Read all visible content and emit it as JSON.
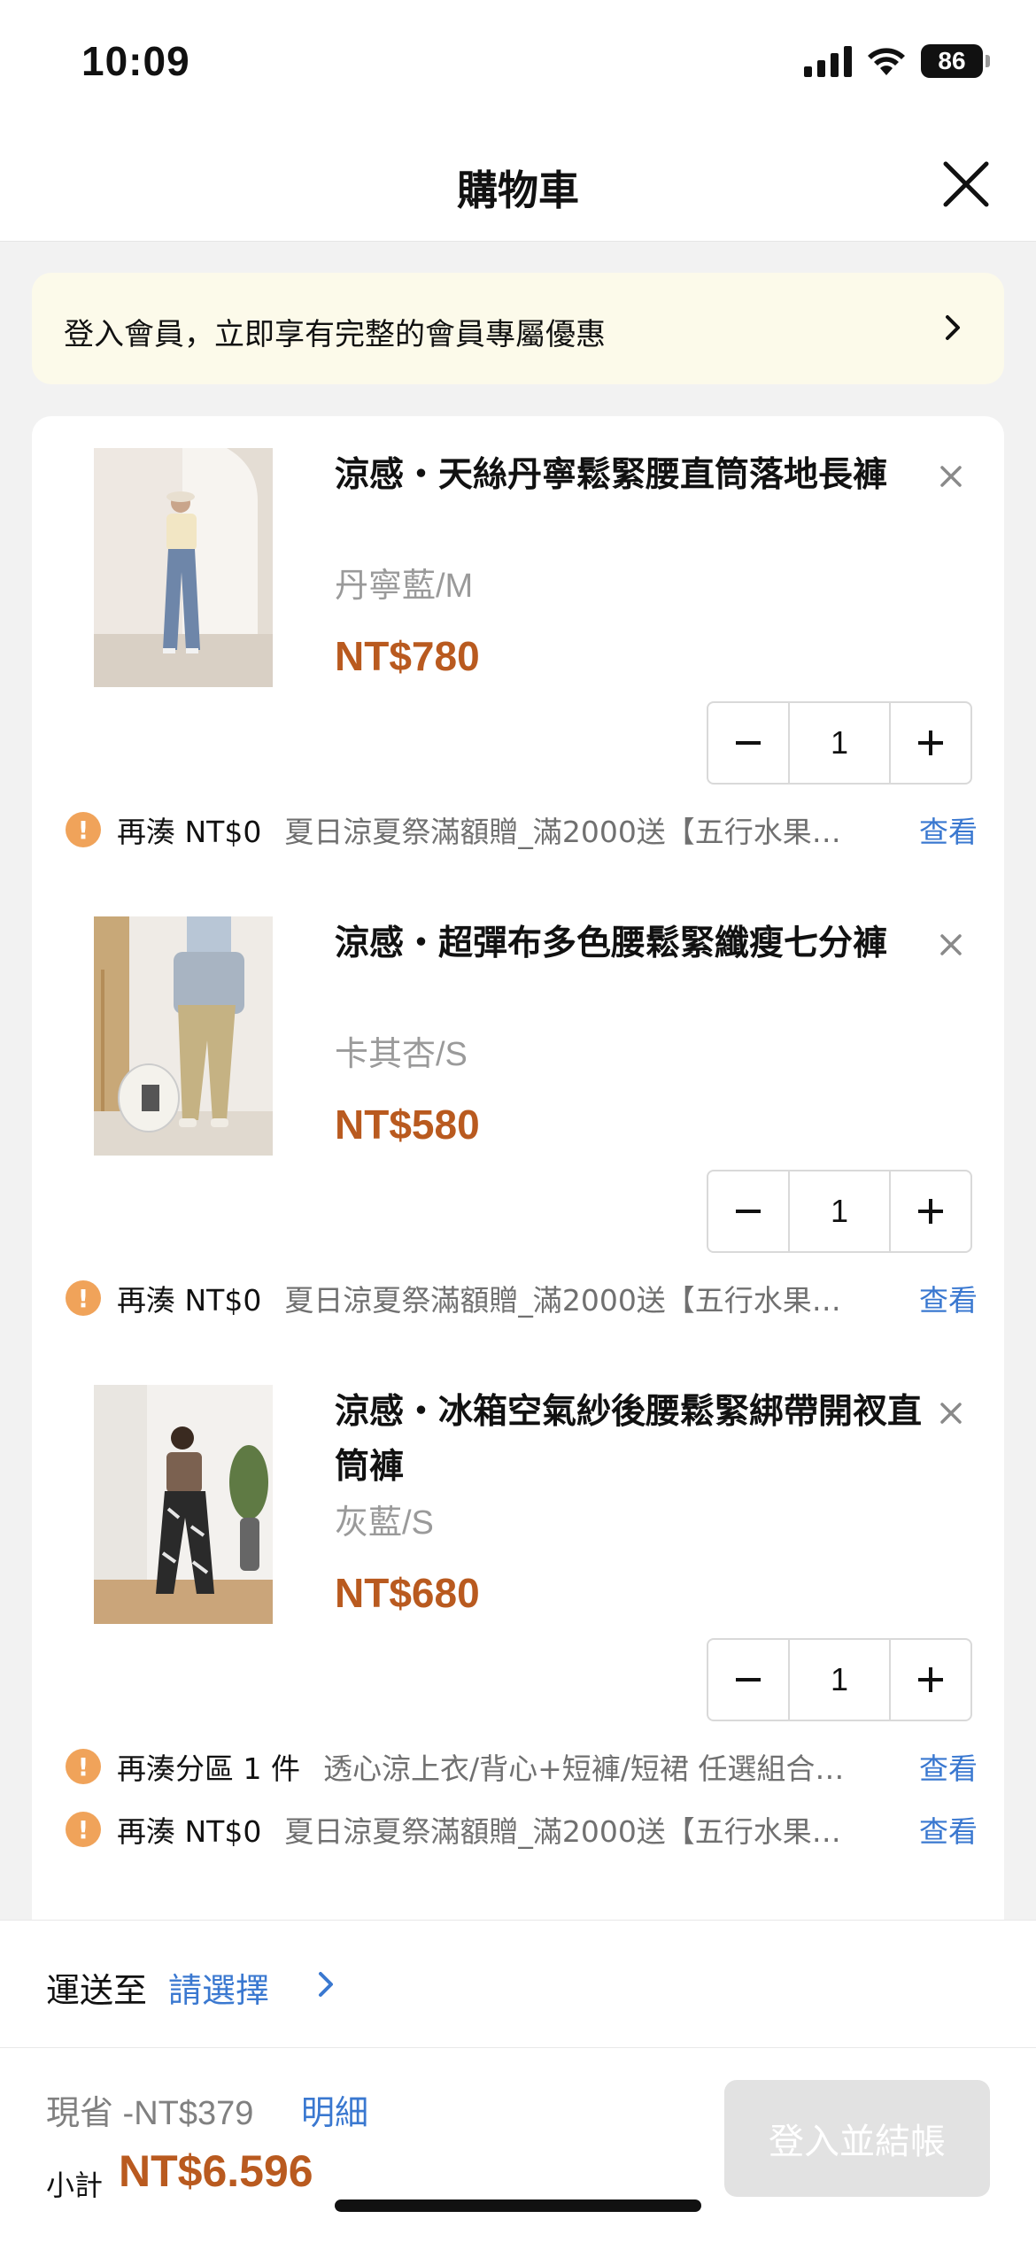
{
  "status": {
    "time": "10:09",
    "battery": "86"
  },
  "header": {
    "title": "購物車"
  },
  "member_banner": {
    "text": "登入會員，立即享有完整的會員專屬優惠"
  },
  "items": [
    {
      "name": "涼感・天絲丹寧鬆緊腰直筒落地長褲",
      "variant": "丹寧藍/M",
      "price": "NT$780",
      "quantity": "1",
      "promos": [
        {
          "need": "再湊 NT$0",
          "desc": "夏日涼夏祭滿額贈_滿2000送【五行水果…",
          "link": "查看"
        }
      ]
    },
    {
      "name": "涼感・超彈布多色腰鬆緊纖瘦七分褲",
      "variant": "卡其杏/S",
      "price": "NT$580",
      "quantity": "1",
      "promos": [
        {
          "need": "再湊 NT$0",
          "desc": "夏日涼夏祭滿額贈_滿2000送【五行水果…",
          "link": "查看"
        }
      ]
    },
    {
      "name": "涼感・冰箱空氣紗後腰鬆緊綁帶開衩直筒褲",
      "variant": "灰藍/S",
      "price": "NT$680",
      "quantity": "1",
      "promos": [
        {
          "need": "再湊分區 1 件",
          "desc": "透心涼上衣/背心+短褲/短裙 任選組合…",
          "link": "查看"
        },
        {
          "need": "再湊 NT$0",
          "desc": "夏日涼夏祭滿額贈_滿2000送【五行水果…",
          "link": "查看"
        }
      ]
    }
  ],
  "shipping": {
    "label": "運送至",
    "select": "請選擇"
  },
  "footer": {
    "saving": "現省 -NT$379",
    "detail_link": "明細",
    "subtotal_label": "小計",
    "subtotal_value": "NT$6.596",
    "checkout": "登入並結帳"
  },
  "colors": {
    "price": "#b95a1f",
    "link": "#3a78d0",
    "banner_bg": "#fcfaea",
    "promo_icon": "#f0a35a"
  }
}
